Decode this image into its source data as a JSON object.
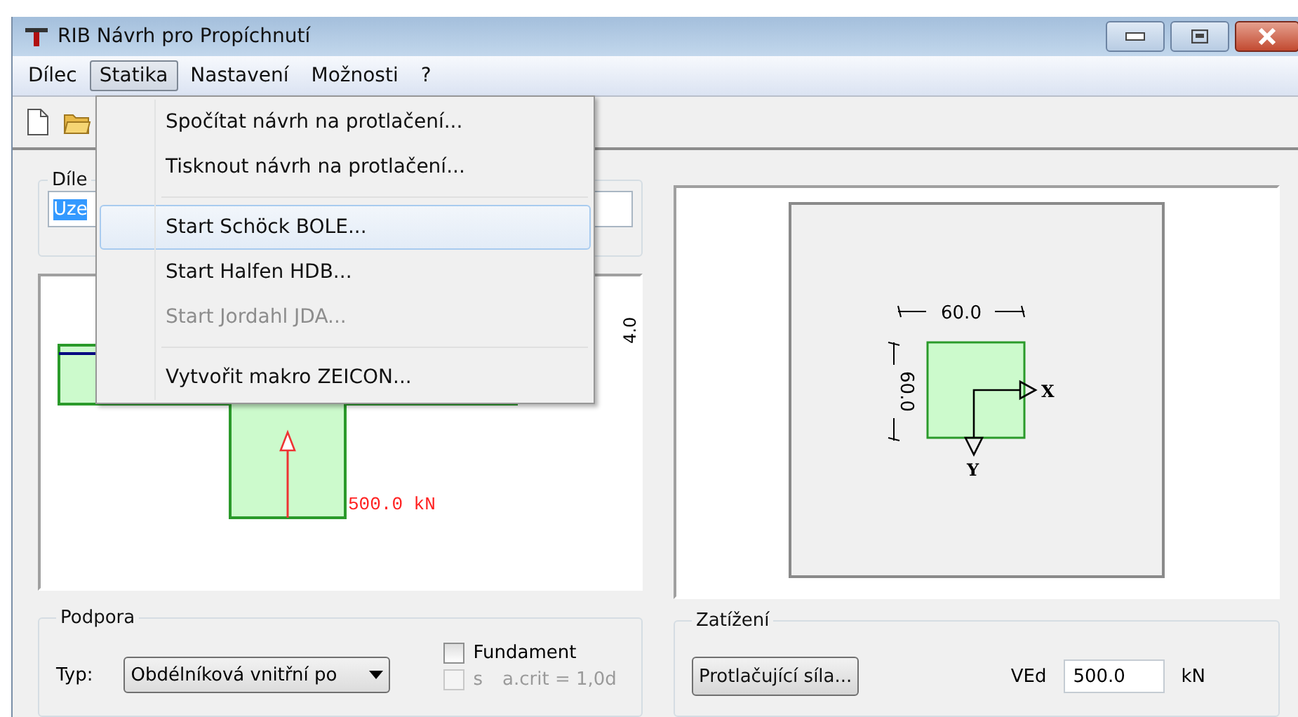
{
  "window": {
    "title": "RIB Návrh pro Propíchnutí"
  },
  "menu_bar": [
    {
      "label": "Dílec",
      "selected": false
    },
    {
      "label": "Statika",
      "selected": true
    },
    {
      "label": "Nastavení",
      "selected": false
    },
    {
      "label": "Možnosti",
      "selected": false
    },
    {
      "label": "?",
      "selected": false
    }
  ],
  "dropdown": {
    "items": [
      {
        "kind": "item",
        "label": "Spočítat návrh na protlačení...",
        "selected": false,
        "disabled": false
      },
      {
        "kind": "item",
        "label": "Tisknout návrh na protlačení...",
        "selected": false,
        "disabled": false
      },
      {
        "kind": "separator"
      },
      {
        "kind": "item",
        "label": "Start Schöck BOLE...",
        "selected": true,
        "disabled": false
      },
      {
        "kind": "item",
        "label": "Start Halfen HDB...",
        "selected": false,
        "disabled": false
      },
      {
        "kind": "item",
        "label": "Start Jordahl JDA...",
        "selected": false,
        "disabled": true
      },
      {
        "kind": "separator"
      },
      {
        "kind": "item",
        "label": "Vytvořit makro ZEICON...",
        "selected": false,
        "disabled": false
      }
    ]
  },
  "member_group": {
    "title": "Díle",
    "value": "Uze"
  },
  "elevation_view": {
    "load_label": "500.0 kN",
    "dimension_label": "4.0"
  },
  "plan_view": {
    "width_label": "60.0",
    "height_label": "60.0",
    "axis_x": "X",
    "axis_y": "Y"
  },
  "support_group": {
    "title": "Podpora",
    "type_label": "Typ:",
    "type_value": "Obdélníková vnitřní po",
    "checkboxes": [
      {
        "label": "Fundament",
        "checked": false,
        "disabled": false
      },
      {
        "label": "s",
        "note": "a.crit = 1,0d",
        "checked": false,
        "disabled": true
      }
    ]
  },
  "load_group": {
    "title": "Zatížení",
    "button": "Protlačující síla...",
    "fields": [
      {
        "label": "VEd",
        "value": "500.0",
        "unit": "kN"
      }
    ]
  }
}
